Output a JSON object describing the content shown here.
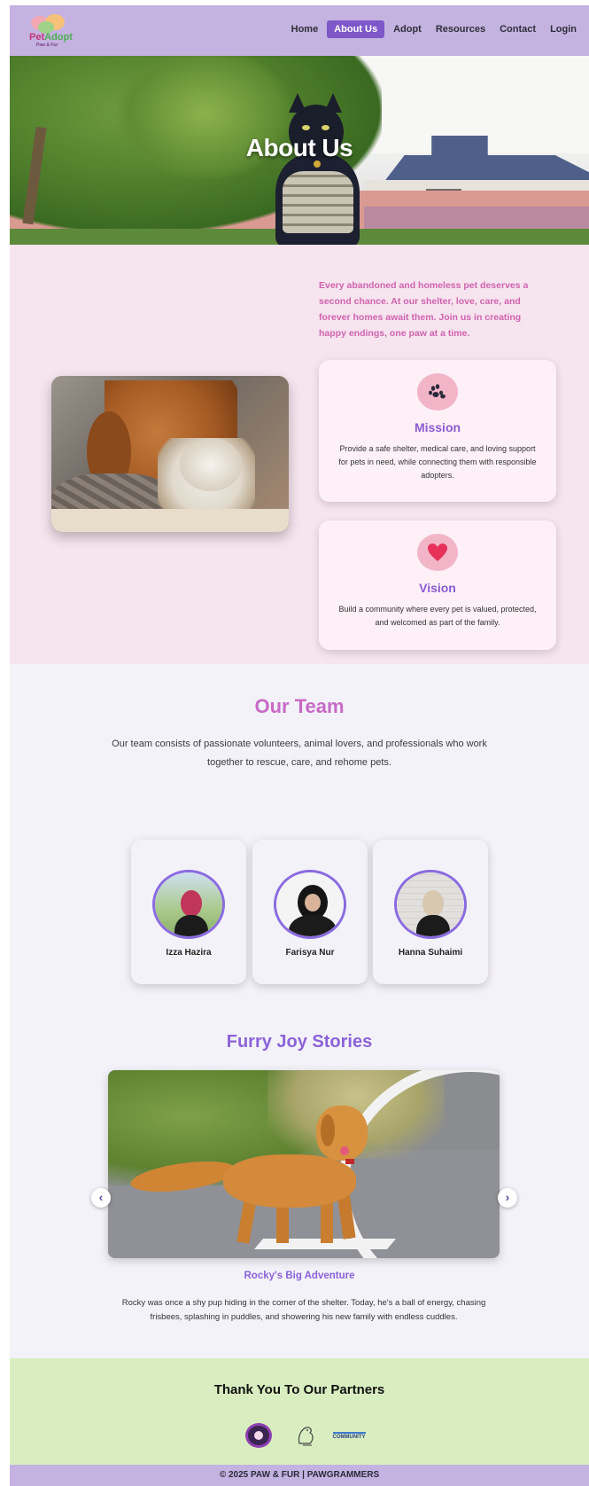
{
  "brand": {
    "logo_text_primary": "Pet",
    "logo_text_secondary": "Adopt",
    "logo_tagline": "Paw & Fur"
  },
  "nav": {
    "items": [
      {
        "label": "Home",
        "active": false
      },
      {
        "label": "About Us",
        "active": true
      },
      {
        "label": "Adopt",
        "active": false
      },
      {
        "label": "Resources",
        "active": false
      },
      {
        "label": "Contact",
        "active": false
      },
      {
        "label": "Login",
        "active": false
      }
    ]
  },
  "hero": {
    "title": "About Us"
  },
  "about": {
    "intro": "Every abandoned and homeless pet deserves a second chance. At our shelter, love, care, and forever homes await them. Join us in creating happy endings, one paw at a time.",
    "mission": {
      "icon": "paw-icon",
      "title": "Mission",
      "text": "Provide a safe shelter, medical care, and loving support for pets in need, while connecting them with responsible adopters."
    },
    "vision": {
      "icon": "heart-icon",
      "title": "Vision",
      "text": "Build a community where every pet is valued, protected, and welcomed as part of the family."
    }
  },
  "team": {
    "title": "Our Team",
    "description": "Our team consists of passionate volunteers, animal lovers, and professionals who work together to rescue, care, and rehome pets.",
    "members": [
      {
        "name": "Izza Hazira"
      },
      {
        "name": "Farisya Nur"
      },
      {
        "name": "Hanna Suhaimi"
      }
    ]
  },
  "stories": {
    "title": "Furry Joy Stories",
    "prev_label": "‹",
    "next_label": "›",
    "current": {
      "title": "Rocky's Big Adventure",
      "text": "Rocky was once a shy pup hiding in the corner of the shelter. Today, he's a ball of energy, chasing frisbees, splashing in puddles, and showering his new family with endless cuddles."
    }
  },
  "partners": {
    "title": "Thank You To Our Partners",
    "logos": [
      "partner-badge-logo",
      "partner-sketch-logo",
      "partner-community-logo"
    ],
    "community_label": "COMMUNITY"
  },
  "footer": {
    "text": "© 2025 PAW & FUR | PAWGRAMMERS"
  },
  "colors": {
    "header_bg": "#c4b2e0",
    "active_nav": "#7e57c8",
    "about_bg": "#f6e4ee",
    "accent_pink": "#cf63b0",
    "accent_purple": "#8b5bd1",
    "partners_bg": "#d9eec0"
  }
}
